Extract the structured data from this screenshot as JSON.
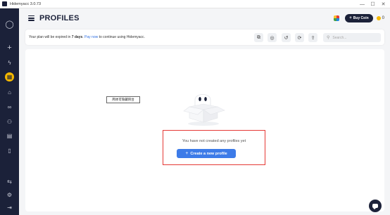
{
  "window": {
    "title": "Hidemyacc 3.0.73",
    "controls": [
      "—",
      "☐",
      "✕"
    ]
  },
  "sidebar": {
    "items": [
      {
        "icon": "user-icon",
        "glyph": "◯"
      },
      {
        "icon": "plus-icon",
        "glyph": "+"
      },
      {
        "icon": "lightning-icon",
        "glyph": "ϟ"
      },
      {
        "icon": "profiles-grid-icon",
        "glyph": "▦",
        "active": true
      },
      {
        "icon": "robot-icon",
        "glyph": "⌂"
      },
      {
        "icon": "link-icon",
        "glyph": "∞"
      },
      {
        "icon": "group-icon",
        "glyph": "⚇"
      },
      {
        "icon": "storage-icon",
        "glyph": "▤"
      },
      {
        "icon": "document-icon",
        "glyph": "▯"
      },
      {
        "icon": "sync-icon",
        "glyph": "⇆"
      },
      {
        "icon": "settings-icon",
        "glyph": "⚙"
      },
      {
        "icon": "logout-icon",
        "glyph": "⇥"
      }
    ]
  },
  "header": {
    "title": "PROFILES",
    "buy_coin_label": "Buy Coin",
    "buy_coin_plus": "+",
    "coin_count": "0"
  },
  "notice": {
    "text_before": "Your plan will be expired in ",
    "days": "7 days",
    "text_middle": ". ",
    "pay_link": "Pay now",
    "text_after": " to continue using Hidemyacc."
  },
  "toolbar": {
    "buttons": [
      {
        "name": "import-icon",
        "glyph": "⧉"
      },
      {
        "name": "proxy-icon",
        "glyph": "◎"
      },
      {
        "name": "history-icon",
        "glyph": "↺"
      },
      {
        "name": "refresh-icon",
        "glyph": "⟳"
      },
      {
        "name": "upload-icon",
        "glyph": "⇪"
      }
    ],
    "search_placeholder": "Search..."
  },
  "overlay": {
    "tooltip_text": "简体可隐藏目台"
  },
  "empty_state": {
    "message": "You have not created any profiles yet",
    "create_button_label": "Create a new profile",
    "create_button_plus": "+"
  },
  "colors": {
    "sidebar_bg": "#1b2139",
    "active_accent": "#f5b800",
    "primary_button": "#3d7be8",
    "highlight_border": "#e53935",
    "link": "#2f6fe0"
  }
}
